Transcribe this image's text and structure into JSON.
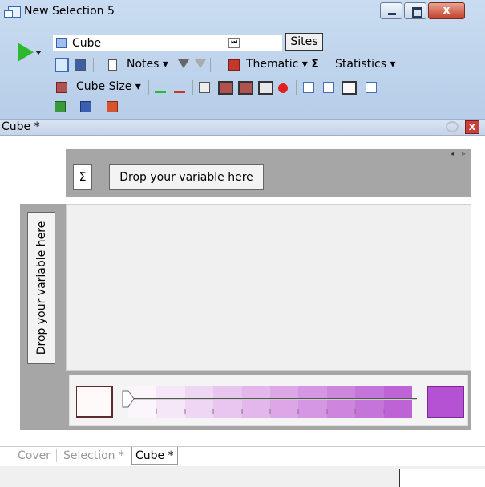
{
  "window": {
    "title": "New Selection 5",
    "close_glyph": "x"
  },
  "toolbar": {
    "cube_name": "Cube",
    "sites_label": "Sites",
    "notes_label": "Notes",
    "thematic_label": "Thematic",
    "sigma_glyph": "Σ",
    "statistics_label": "Statistics",
    "cube_size_label": "Cube Size",
    "dropdown_glyph": "▾",
    "end_glyph": "⏭"
  },
  "panel": {
    "title": "Cube *",
    "close_glyph": "x"
  },
  "cube": {
    "sigma": "Σ",
    "column_drop": "Drop your variable here",
    "row_drop": "Drop your variable here",
    "scroll_arrows": "◂ ▹"
  },
  "legend": {
    "min_color": "#fffafa",
    "max_color": "#b552d4",
    "ramp": [
      "#fcf5fc",
      "#f5e6f8",
      "#efd6f4",
      "#e9c6f0",
      "#e3b6ec",
      "#dca6e7",
      "#d596e3",
      "#cd85de",
      "#c574d9",
      "#bd63d5"
    ]
  },
  "tabs": [
    "Cover",
    "Selection *",
    "Cube *"
  ],
  "colors": {
    "play": "#2eb82e",
    "panel_bg": "#a6a6a6",
    "accent": "#b552d4"
  }
}
